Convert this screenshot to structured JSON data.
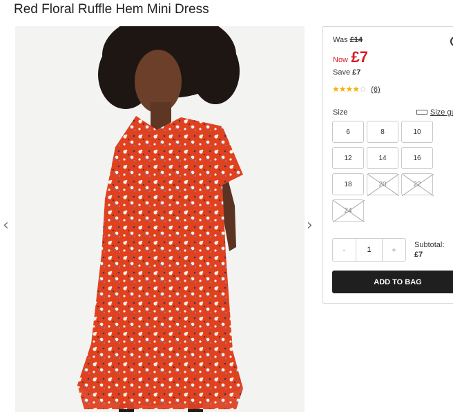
{
  "product": {
    "title": "Red Floral Ruffle Hem Mini Dress"
  },
  "gallery": {
    "prev_icon": "chevron-left-icon",
    "next_icon": "chevron-right-icon"
  },
  "price": {
    "was_label": "Was",
    "was_value": "£14",
    "now_label": "Now",
    "now_value": "£7",
    "save_label": "Save",
    "save_value": "£7",
    "sale_color": "#d61f26"
  },
  "rating": {
    "stars": 4,
    "max": 5,
    "count": "(6)",
    "star_color": "#f3b200"
  },
  "size": {
    "label": "Size",
    "guide_label": "Size gu",
    "options": [
      {
        "label": "6",
        "available": true
      },
      {
        "label": "8",
        "available": true
      },
      {
        "label": "10",
        "available": true
      },
      {
        "label": "12",
        "available": true
      },
      {
        "label": "14",
        "available": true
      },
      {
        "label": "16",
        "available": true
      },
      {
        "label": "18",
        "available": true
      },
      {
        "label": "20",
        "available": false
      },
      {
        "label": "22",
        "available": false
      },
      {
        "label": "24",
        "available": false
      }
    ]
  },
  "quantity": {
    "minus": "-",
    "value": "1",
    "plus": "+"
  },
  "subtotal": {
    "label": "Subtotal:",
    "value": "£7"
  },
  "add_to_bag": {
    "label": "ADD TO BAG"
  }
}
